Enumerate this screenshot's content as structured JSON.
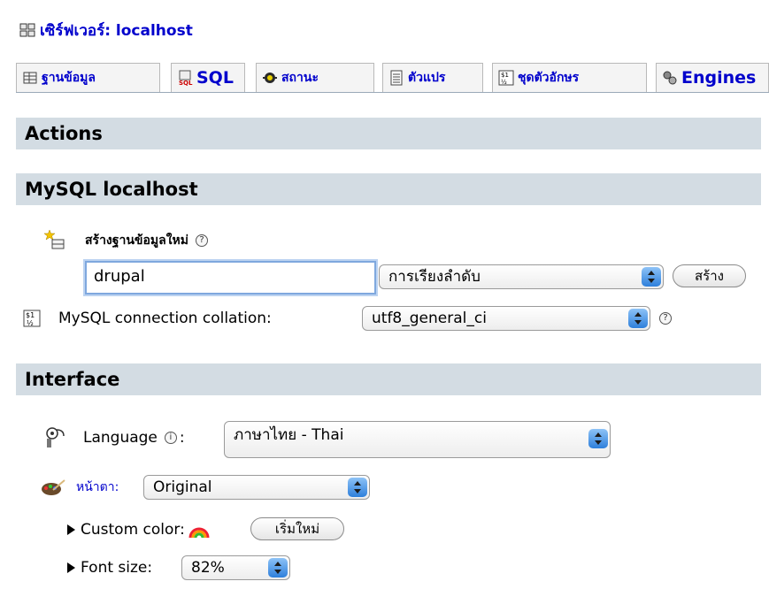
{
  "server": {
    "label": "เซิร์ฟเวอร์: localhost",
    "icon": "server-icon"
  },
  "tabs": [
    {
      "label": "ฐานข้อมูล",
      "icon": "database-icon"
    },
    {
      "label": "SQL",
      "icon": "sql-icon"
    },
    {
      "label": "สถานะ",
      "icon": "status-icon"
    },
    {
      "label": "ตัวแปร",
      "icon": "variables-icon"
    },
    {
      "label": "ชุดตัวอักษร",
      "icon": "charset-icon"
    },
    {
      "label": "Engines",
      "icon": "engines-icon"
    }
  ],
  "actions": {
    "title": "Actions"
  },
  "mysql": {
    "title": "MySQL localhost",
    "create_db": {
      "label": "สร้างฐานข้อมูลใหม่",
      "input_value": "drupal",
      "collation_select": "การเรียงลำดับ",
      "create_button": "สร้าง"
    },
    "connection": {
      "label": "MySQL connection collation:",
      "select_value": "utf8_general_ci"
    }
  },
  "interface": {
    "title": "Interface",
    "language": {
      "label": "Language",
      "colon": ":",
      "select_value": "ภาษาไทย - Thai"
    },
    "theme": {
      "label": "หน้าตา:",
      "select_value": "Original"
    },
    "custom_color": {
      "label": "Custom color:",
      "reset_button": "เริ่มใหม่"
    },
    "font_size": {
      "label": "Font size:",
      "select_value": "82%"
    }
  },
  "help_glyph": "?",
  "info_glyph": "i",
  "colors": {
    "link": "#0000cc",
    "section_bg": "#d3dce3",
    "caret_blue": "#2e7fdb"
  }
}
